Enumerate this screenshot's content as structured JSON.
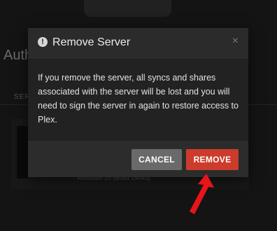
{
  "background": {
    "title": "Auth",
    "tab_label": "SERV",
    "device_text": "Windows 10 (Build 19043)"
  },
  "dialog": {
    "title": "Remove Server",
    "message": "If you remove the server, all syncs and shares associated with the server will be lost and you will need to sign the server in again to restore access to Plex.",
    "close_glyph": "×",
    "alert_glyph": "!",
    "cancel_label": "CANCEL",
    "remove_label": "REMOVE"
  },
  "colors": {
    "remove_button": "#cc3b2b",
    "cancel_button": "#6a6a6a",
    "annotation_arrow": "#e8141a"
  },
  "icons": [
    "alert-circle-icon",
    "close-icon",
    "annotation-arrow-icon"
  ]
}
